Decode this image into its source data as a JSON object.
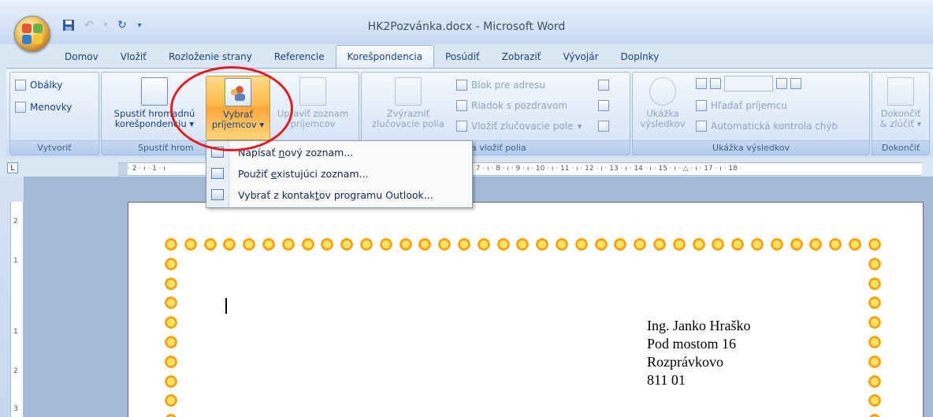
{
  "window": {
    "title": "HK2Pozvánka.docx - Microsoft Word"
  },
  "quick_access": [
    "save-icon",
    "undo-icon",
    "redo-icon",
    "customize-icon"
  ],
  "tabs": [
    "Domov",
    "Vložiť",
    "Rozloženie strany",
    "Referencie",
    "Korešpondencia",
    "Posúdiť",
    "Zobraziť",
    "Vývojár",
    "Doplnky"
  ],
  "active_tab": "Korešpondencia",
  "ribbon": {
    "vytvorit": {
      "label": "Vytvoriť",
      "obalky": "Obálky",
      "menovky": "Menovky"
    },
    "spustit": {
      "label": "Spustiť hrom",
      "spustit_line1": "Spustiť hromadnú",
      "spustit_line2": "korešpondenciu",
      "vybrat_line1": "Vybrať",
      "vybrat_line2": "príjemcov",
      "upravit_line1": "Upraviť zoznam",
      "upravit_line2": "príjemcov"
    },
    "zapisat": {
      "label": "ť a vložiť polia",
      "zvyraznit_line1": "Zvýrazniť",
      "zvyraznit_line2": "zlučovacie polia",
      "blok": "Blok pre adresu",
      "riadok": "Riadok s pozdravom",
      "vlozit": "Vložiť zlučovacie pole"
    },
    "ukazka": {
      "label": "Ukážka výsledkov",
      "ukazka_line1": "Ukážka",
      "ukazka_line2": "výsledkov",
      "hladat": "Hľadať príjemcu",
      "kontrola": "Automatická kontrola chýb"
    },
    "dokoncit": {
      "label": "Dokončiť",
      "btn_line1": "Dokončiť",
      "btn_line2": "& zlúčiť"
    }
  },
  "dropdown": {
    "items": [
      {
        "pre": "Napísať ",
        "u": "n",
        "post": "ový zoznam..."
      },
      {
        "pre": "Použiť ",
        "u": "e",
        "post": "xistujúci zoznam..."
      },
      {
        "pre": "Vybrať z kontak",
        "u": "t",
        "post": "ov programu Outlook..."
      }
    ]
  },
  "ruler": {
    "left_ticks": "· 2 · ı · 1 · ı",
    "right_ticks": "· 7 · ı · 8 · ı · 9 · ı · 10 · ı · 11 · ı · 12 · ı · 13 · ı · 14 · ı · 15 · ı · △ · ı · 17 · ı · 18 ·",
    "corner": "L",
    "vertical": [
      "2",
      "1",
      "1",
      "2",
      "3"
    ]
  },
  "document": {
    "address": [
      "Ing. Janko Hraško",
      "Pod mostom 16",
      "Rozprávkovo",
      "811 01"
    ]
  }
}
